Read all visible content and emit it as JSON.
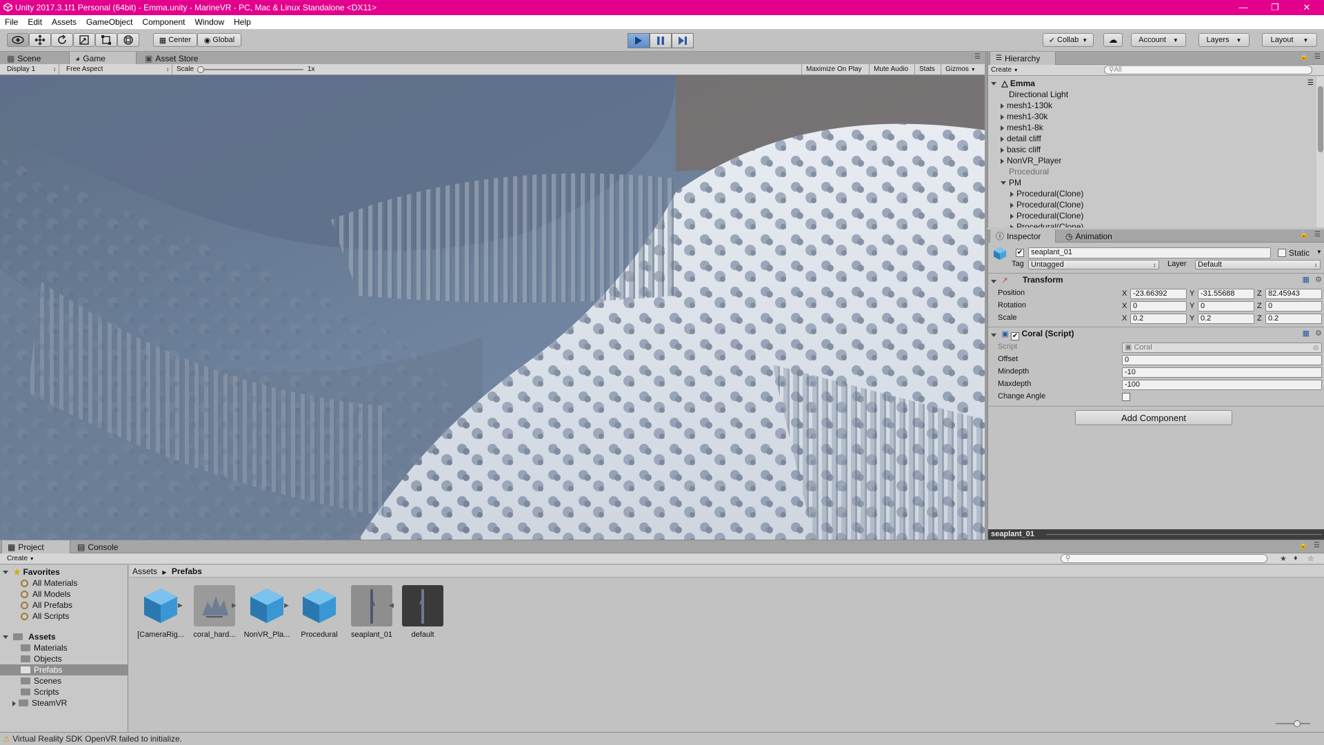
{
  "window": {
    "title": "Unity 2017.3.1f1 Personal (64bit) - Emma.unity - MarineVR - PC, Mac & Linux Standalone <DX11>",
    "controls": [
      "minimize-icon",
      "restore-icon",
      "close-icon"
    ]
  },
  "menu": [
    "File",
    "Edit",
    "Assets",
    "GameObject",
    "Component",
    "Window",
    "Help"
  ],
  "toolbar": {
    "pivot": "Center",
    "space": "Global",
    "collab": "Collab",
    "account": "Account",
    "layers": "Layers",
    "layout": "Layout"
  },
  "scene_tabs": [
    "Scene",
    "Game",
    "Asset Store"
  ],
  "game_bar": {
    "display": "Display 1",
    "aspect": "Free Aspect",
    "scale_label": "Scale",
    "scale_value": "1x",
    "maximize": "Maximize On Play",
    "mute": "Mute Audio",
    "stats": "Stats",
    "gizmos": "Gizmos"
  },
  "hierarchy": {
    "tab": "Hierarchy",
    "create": "Create",
    "search_placeholder": "All",
    "scene": "Emma",
    "items": [
      {
        "label": "Directional Light",
        "arrow": false
      },
      {
        "label": "mesh1-130k",
        "arrow": true
      },
      {
        "label": "mesh1-30k",
        "arrow": true
      },
      {
        "label": "mesh1-8k",
        "arrow": true
      },
      {
        "label": "detail cliff",
        "arrow": true
      },
      {
        "label": "basic cliff",
        "arrow": true
      },
      {
        "label": "NonVR_Player",
        "arrow": true
      },
      {
        "label": "Procedural",
        "arrow": false
      },
      {
        "label": "PM",
        "arrow": true
      },
      {
        "label": "Procedural(Clone)",
        "arrow": true
      },
      {
        "label": "Procedural(Clone)",
        "arrow": true
      },
      {
        "label": "Procedural(Clone)",
        "arrow": true
      },
      {
        "label": "Procedural(Clone)",
        "arrow": true
      }
    ]
  },
  "inspector": {
    "tabs": [
      "Inspector",
      "Animation"
    ],
    "object_name": "seaplant_01",
    "static_label": "Static",
    "tag_label": "Tag",
    "tag_value": "Untagged",
    "layer_label": "Layer",
    "layer_value": "Default",
    "transform": {
      "title": "Transform",
      "position_label": "Position",
      "rotation_label": "Rotation",
      "scale_label": "Scale",
      "position": {
        "x": "-23.66392",
        "y": "-31.55688",
        "z": "82.45943"
      },
      "rotation": {
        "x": "0",
        "y": "0",
        "z": "0"
      },
      "scale": {
        "x": "0.2",
        "y": "0.2",
        "z": "0.2"
      }
    },
    "script": {
      "title": "Coral (Script)",
      "script_label": "Script",
      "script_value": "Coral",
      "offset_label": "Offset",
      "offset": "0",
      "mindepth_label": "Mindepth",
      "mindepth": "-10",
      "maxdepth_label": "Maxdepth",
      "maxdepth": "-100",
      "change_angle_label": "Change Angle"
    },
    "add_component": "Add Component",
    "preview_label": "seaplant_01"
  },
  "project": {
    "tabs": [
      "Project",
      "Console"
    ],
    "create": "Create",
    "favorites_label": "Favorites",
    "favorites": [
      "All Materials",
      "All Models",
      "All Prefabs",
      "All Scripts"
    ],
    "assets_label": "Assets",
    "folders": [
      "Materials",
      "Objects",
      "Prefabs",
      "Scenes",
      "Scripts",
      "SteamVR"
    ],
    "breadcrumb": [
      "Assets",
      "Prefabs"
    ],
    "asset_items": [
      "[CameraRig...",
      "coral_hard...",
      "NonVR_Pla...",
      "Procedural",
      "seaplant_01",
      "default"
    ]
  },
  "status": {
    "message": "Virtual Reality SDK OpenVR failed to initialize."
  }
}
